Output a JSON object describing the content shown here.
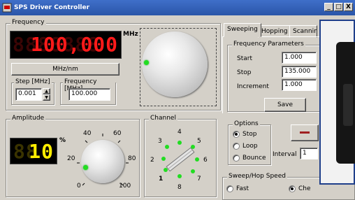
{
  "window": {
    "title": "SPS Driver Controller",
    "btn_min": "_",
    "btn_max": "□",
    "btn_close": "X"
  },
  "frequency": {
    "group_label": "Frequency",
    "display": "100,000",
    "ghost": "8888888",
    "unit": "MHz",
    "unit_button": "MHz/nm",
    "step_label": "Step [MHz]",
    "step_value": "0.001",
    "freq_label": "Frequency [MHz]",
    "freq_value": "100.000"
  },
  "amplitude": {
    "group_label": "Amplitude",
    "display": "10",
    "ghost": "88",
    "unit": "%",
    "scale": [
      "0",
      "20",
      "40",
      "60",
      "80",
      "100"
    ]
  },
  "channel": {
    "group_label": "Channel",
    "numbers": [
      "1",
      "2",
      "3",
      "4",
      "5",
      "6",
      "7",
      "8"
    ]
  },
  "tabs": [
    "Sweeping",
    "Hopping",
    "Scanning"
  ],
  "sweeping": {
    "params_label": "Frequency Parameters",
    "start_label": "Start",
    "start_value": "1.000",
    "stop_label": "Stop",
    "stop_value": "135.000",
    "increment_label": "Increment",
    "increment_value": "1.000",
    "save_button": "Save"
  },
  "options": {
    "group_label": "Options",
    "items": [
      {
        "label": "Stop",
        "selected": true
      },
      {
        "label": "Loop",
        "selected": false
      },
      {
        "label": "Bounce",
        "selected": false
      }
    ],
    "interval_label": "Interval",
    "interval_value": "1"
  },
  "speed": {
    "group_label": "Sweep/Hop Speed",
    "fast_label": "Fast",
    "check_label": "Che"
  },
  "colors": {
    "led_red": "#ff1a1a",
    "led_yellow": "#ffee00",
    "titlebar": "#2f5eb5"
  }
}
